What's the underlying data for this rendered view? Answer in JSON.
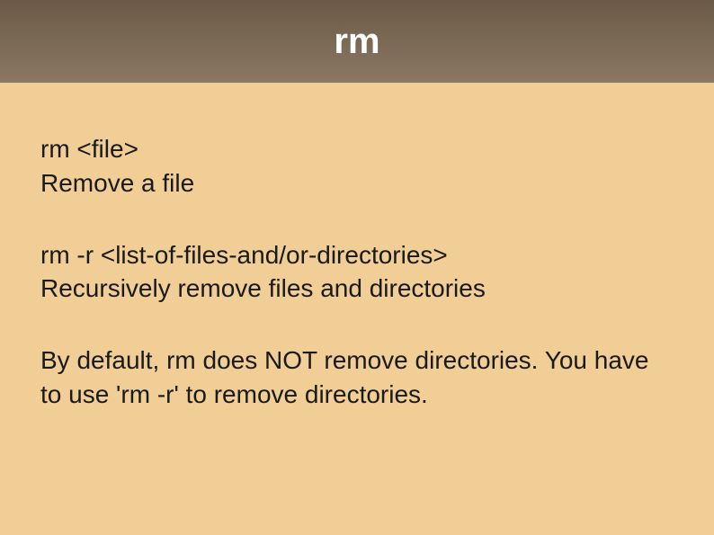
{
  "header": {
    "title": "rm"
  },
  "content": {
    "block1": {
      "line1": "rm <file>",
      "line2": "Remove a file"
    },
    "block2": {
      "line1": "rm -r <list-of-files-and/or-directories>",
      "line2": "Recursively remove files and directories"
    },
    "block3": {
      "text": "By default, rm does NOT remove directories. You have to use 'rm -r' to remove directories."
    }
  }
}
